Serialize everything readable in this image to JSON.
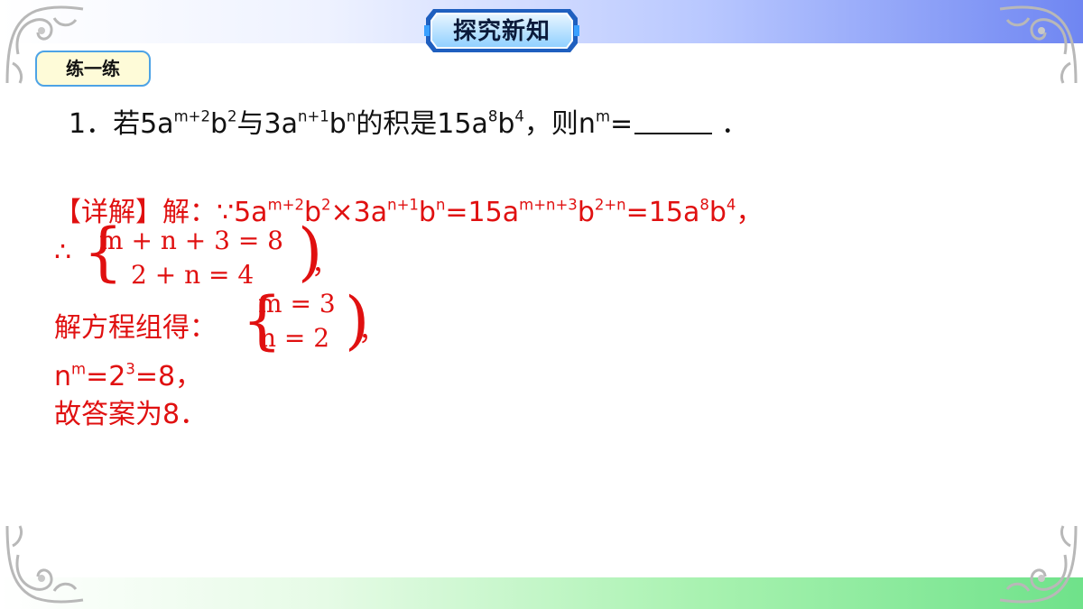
{
  "header": {
    "title": "探究新知"
  },
  "tag": {
    "label": "练一练"
  },
  "question": {
    "num": "1．",
    "p1": "若5a",
    "s1": "m+2",
    "p2": "b",
    "s2": "2",
    "p3": "与3a",
    "s3": "n+1",
    "p4": "b",
    "s4": "n",
    "p5": "的积是15a",
    "s5": "8",
    "p6": "b",
    "s6": "4",
    "p7": "，则n",
    "s7": "m",
    "p8": "=",
    "p9": "．"
  },
  "solution": {
    "l1": {
      "p1": "【详解】解：∵5a",
      "s1": "m+2",
      "p2": "b",
      "s2": "2",
      "p3": "×3a",
      "s3": "n+1",
      "p4": "b",
      "s4": "n",
      "p5": "=15a",
      "s5": "m+n+3",
      "p6": "b",
      "s6": "2+n",
      "p7": "=15a",
      "s7": "8",
      "p8": "b",
      "s8": "4",
      "p9": "，"
    },
    "therefore": "∴",
    "system1": {
      "eq1": "m + n + 3 = 8",
      "eq2": "2 + n = 4",
      "tail": "，"
    },
    "l3": "解方程组得：",
    "system2": {
      "eq1": "m = 3",
      "eq2": "n = 2",
      "tail": "，"
    },
    "l4": {
      "p1": "n",
      "s1": "m",
      "p2": "=2",
      "s2": "3",
      "p3": "=8，"
    },
    "l5": "故答案为8．"
  },
  "colors": {
    "answer_red": "#e01010",
    "tag_border": "#4da3e6",
    "tag_fill": "#fefbd8"
  }
}
